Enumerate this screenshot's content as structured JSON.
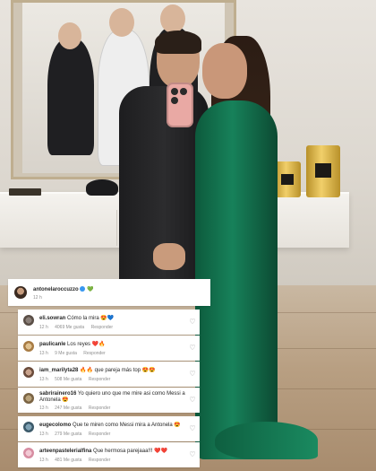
{
  "main_comment": {
    "username": "antonelaroccuzzo",
    "time": "12 h",
    "verified_icon": "verified-badge-icon",
    "emoji": "💚"
  },
  "comments": [
    {
      "username": "eli.sowran",
      "text": "Cómo la mira",
      "emoji": "😍💙",
      "time": "12 h",
      "likes": "4069 Me gusta",
      "reply": "Responder"
    },
    {
      "username": "paulicanle",
      "text": "Los reyes",
      "emoji": "❤️🔥",
      "time": "13 h",
      "likes": "9 Me gusta",
      "reply": "Responder"
    },
    {
      "username": "iam_marilyta28",
      "text": "que pareja más top",
      "emoji_before": "🔥🔥",
      "emoji": "😍😍",
      "time": "13 h",
      "likes": "508 Me gusta",
      "reply": "Responder"
    },
    {
      "username": "sabrirainero16",
      "text": "Yo quiero uno que me mire asi como Messi a Antonela",
      "emoji": "😍",
      "time": "13 h",
      "likes": "247 Me gusta",
      "reply": "Responder"
    },
    {
      "username": "eugecolomo",
      "text": "Que te miren como Messi mira a Antonela",
      "emoji": "😍",
      "time": "13 h",
      "likes": "279 Me gusta",
      "reply": "Responder"
    },
    {
      "username": "arteenpastelerialfina",
      "text": "Que hermosa parejaaa!!!",
      "emoji": "❤️❤️",
      "time": "13 h",
      "likes": "481 Me gusta",
      "reply": "Responder"
    }
  ],
  "colors": {
    "dress": "#17815a",
    "card": "#ffffff",
    "meta_text": "#8e8e8e",
    "username_text": "#262626"
  }
}
